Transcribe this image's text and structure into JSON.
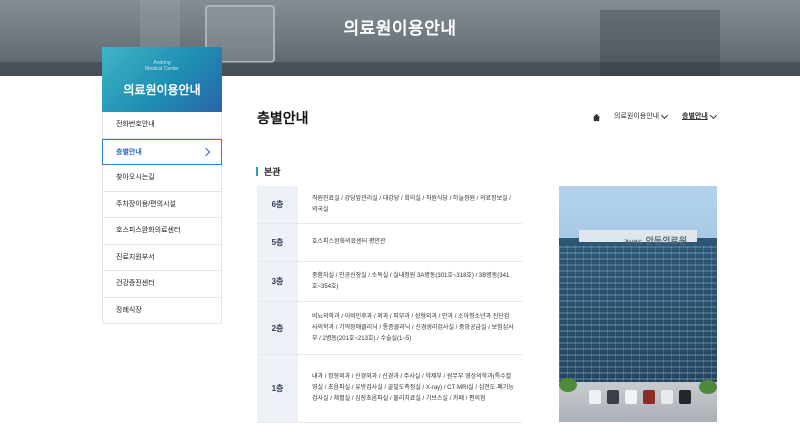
{
  "hero": {
    "title": "의료원이용안내"
  },
  "side": {
    "brand_sub": [
      "Andong",
      "Medical Center"
    ],
    "title": "의료원이용안내",
    "items": [
      {
        "label": "전화번호안내",
        "active": false
      },
      {
        "label": "층별안내",
        "active": true
      },
      {
        "label": "찾아오시는길",
        "active": false
      },
      {
        "label": "주차장이용/편의시설",
        "active": false
      },
      {
        "label": "호스피스완화의료센터",
        "active": false
      },
      {
        "label": "진료지원부서",
        "active": false
      },
      {
        "label": "건강증진센터",
        "active": false
      },
      {
        "label": "장례식장",
        "active": false
      }
    ]
  },
  "page": {
    "title": "층별안내"
  },
  "breadcrumb": {
    "home_icon": "home-icon",
    "level1": "의료원이용안내",
    "level2": "층별안내"
  },
  "section": {
    "title": "본관",
    "accent_color": "#2aa0b0"
  },
  "floors": [
    {
      "floor": "6층",
      "desc": "직원진료실 / 강당앞관리실 / 대강당 / 회의실 / 직원식당 / 하늘정원 / 의료정보실 / 의국실"
    },
    {
      "floor": "5층",
      "desc": "호스피스완화의료센터 평안관"
    },
    {
      "floor": "3층",
      "desc": "중환자실 / 인공신장실 / 소독실 / 실내정원 3A병동(301호~318호) / 3B병동(341호~354호)"
    },
    {
      "floor": "2층",
      "desc": "비뇨의학과 / 이비인후과 / 외과 / 피부과 / 성형외과 / 안과 / 소아청소년과 진단검사의학과 / 기억장애클리닉 / 통증클리닉 / 신경생리검사실 / 중앙공급실 / 보험심사부 / 2병동(201호~213호) / 수술실(1~5)"
    },
    {
      "floor": "1층",
      "desc": "내과 / 정형외과 / 신경외과 / 신경과 / 주사실 / 약제부 / 원무부 영상의학과(특수촬영실 / 초음파실 / 유방검사실 / 골밀도측정실 / X-ray) / CT·MRI실 / 심전도·폐기능검사실 / 채혈실 / 심장초음파실 / 물리치료실 / 기브스실 / 카페 / 편의점"
    }
  ],
  "photo": {
    "sign_small": "경상북도",
    "sign_main": "안동의료원"
  }
}
